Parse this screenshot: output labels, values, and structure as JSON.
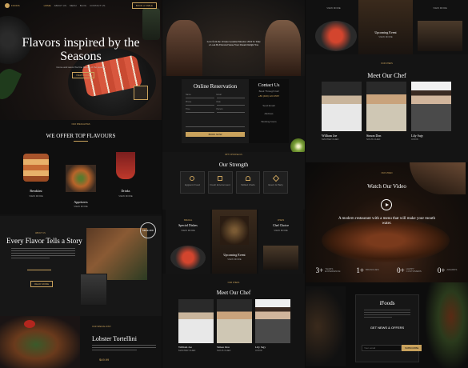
{
  "col1": {
    "logo": "FOODS",
    "nav": [
      "HOME",
      "ABOUT US",
      "MENU",
      "BLOG",
      "CONTACT US"
    ],
    "nav_cta": "BOOK A TABLE",
    "hero_title": "Flavors inspired by the Seasons",
    "hero_sub": "Come and savor the fine flavors of the season",
    "hero_btn": "VIEW MORE",
    "flavours_kicker": "OUR SPECIALITIES",
    "flavours_title": "WE OFFER TOP FLAVOURS",
    "items": [
      {
        "name": "Breakfast",
        "btn": "VIEW MORE"
      },
      {
        "name": "Appetizers",
        "btn": "VIEW MORE"
      },
      {
        "name": "Drinks",
        "btn": "VIEW MORE"
      }
    ],
    "story_kicker": "ABOUT US",
    "story_title": "Every Flavor Tells a Story",
    "story_btn": "READ MORE",
    "story_badge": "SINCE 2000",
    "lobster_kicker": "OUR SPECIAL DISH",
    "lobster_title": "Lobster Tortellini",
    "lobster_price": "$49.99"
  },
  "col2": {
    "quote": "Love from the 10 taste Gourmet Meadow 2024 To Take a Look Be Elevated Sense Your Dream Delight You",
    "res_title": "Online Reservation",
    "res_fields": [
      "Name",
      "Email",
      "Phone",
      "Date",
      "Time",
      "Person"
    ],
    "res_btn": "BOOK NOW",
    "contact_title": "Contact Us",
    "contact_sub": "Book Through Call",
    "contact_phone": "+80 (400) 123 4567",
    "contact_extra": [
      "Send Email",
      "Address",
      "Working hours"
    ],
    "strength_kicker": "WHY CHOOSE US",
    "strength_title": "Our Strength",
    "strengths": [
      "Hygienic Food",
      "Fresh Environment",
      "Skilled Chefs",
      "Event & Party"
    ],
    "cards": [
      {
        "kicker": "SPECIAL",
        "title": "Special Dishes",
        "btn": "VIEW MORE"
      },
      {
        "kicker": "EVENTS",
        "title": "Upcoming Event",
        "btn": "VIEW MORE"
      },
      {
        "kicker": "CHEFS",
        "title": "Chef Choice",
        "btn": "VIEW MORE"
      }
    ],
    "chef_kicker": "OUR CHEFS",
    "chef_title": "Meet Our Chef",
    "chefs": [
      {
        "name": "William Joe",
        "role": "MASTER CHEF"
      },
      {
        "name": "Simon Don",
        "role": "SOUS CHEF"
      },
      {
        "name": "Lily Sujy",
        "role": "COOK"
      }
    ]
  },
  "col3": {
    "top_cards": [
      {
        "btn": "VIEW MORE"
      },
      {
        "title": "Upcoming Event",
        "btn": "VIEW MORE"
      },
      {
        "btn": "VIEW MORE"
      }
    ],
    "chef_kicker": "OUR CHEFS",
    "chef_title": "Meet Our Chef",
    "chefs": [
      {
        "name": "William Joe",
        "role": "MASTER CHEF"
      },
      {
        "name": "Simon Don",
        "role": "SOUS CHEF"
      },
      {
        "name": "Lily Sujy",
        "role": "COOK"
      }
    ],
    "video_kicker": "OUR VIDEO",
    "video_title": "Watch Our Video",
    "tagline": "A modern restaurant with a menu that will make your mouth water.",
    "stats": [
      {
        "num": "3+",
        "label": "YEARS EXPERIENCE"
      },
      {
        "num": "1+",
        "label": "BRANCHES"
      },
      {
        "num": "0+",
        "label": "HAPPY CUSTOMERS"
      },
      {
        "num": "0+",
        "label": "AWARDS"
      }
    ],
    "footer_logo": "iFoods",
    "news_title": "GET NEWS & OFFERS",
    "news_placeholder": "Your email",
    "news_btn": "SUBSCRIBE"
  },
  "colors": {
    "accent": "#c9a25c",
    "bg": "#0c0c0c"
  }
}
